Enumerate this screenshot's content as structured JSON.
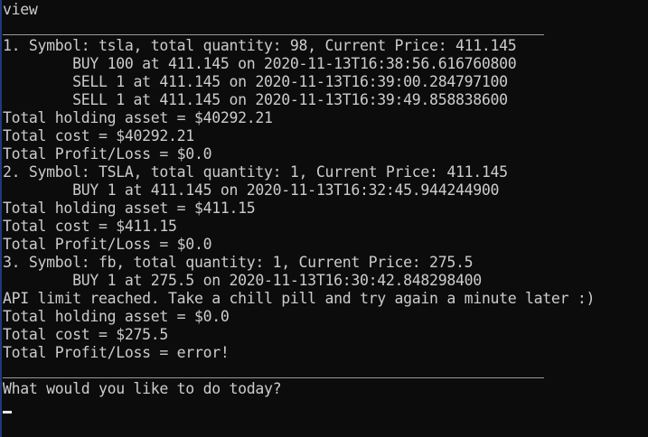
{
  "console": {
    "lines": [
      "view",
      "1. Symbol: tsla, total quantity: 98, Current Price: 411.145",
      "        BUY 100 at 411.145 on 2020-11-13T16:38:56.616760800",
      "        SELL 1 at 411.145 on 2020-11-13T16:39:00.284797100",
      "        SELL 1 at 411.145 on 2020-11-13T16:39:49.858838600",
      "Total holding asset = $40292.21",
      "Total cost = $40292.21",
      "Total Profit/Loss = $0.0",
      "2. Symbol: TSLA, total quantity: 1, Current Price: 411.145",
      "        BUY 1 at 411.145 on 2020-11-13T16:32:45.944244900",
      "Total holding asset = $411.15",
      "Total cost = $411.15",
      "Total Profit/Loss = $0.0",
      "3. Symbol: fb, total quantity: 1, Current Price: 275.5",
      "        BUY 1 at 275.5 on 2020-11-13T16:30:42.848298400",
      "API limit reached. Take a chill pill and try again a minute later :)",
      "Total holding asset = $0.0",
      "Total cost = $275.5",
      "Total Profit/Loss = error!",
      "What would you like to do today?"
    ]
  },
  "colors": {
    "background": "#0c0c0c",
    "text": "#cccccc",
    "rule": "#9a9a9a",
    "cursor": "#e6e6e6"
  }
}
